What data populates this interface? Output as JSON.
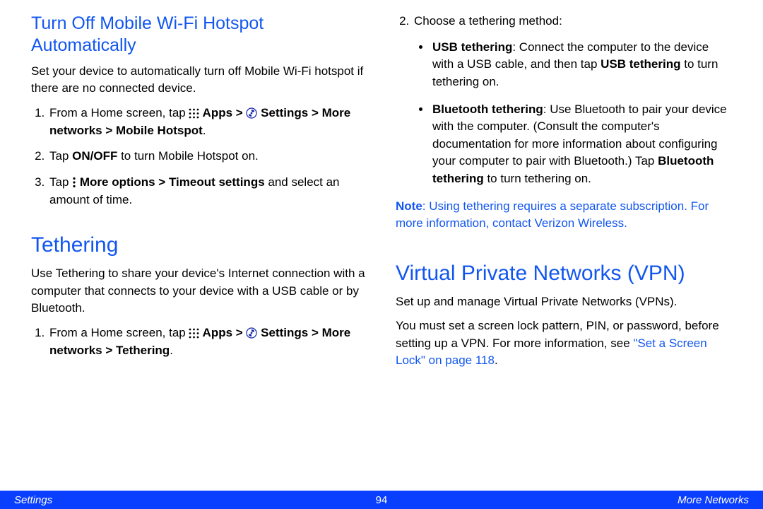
{
  "left": {
    "h2": "Turn Off Mobile Wi-Fi Hotspot Automatically",
    "p1": "Set your device to automatically turn off Mobile Wi-Fi hotspot if there are no connected device.",
    "li1_a": "From a Home screen, tap ",
    "li1_apps": " Apps > ",
    "li1_settings": " Settings > More networks > Mobile Hotspot",
    "li1_dot": ".",
    "li2_a": "Tap ",
    "li2_b": "ON/OFF",
    "li2_c": " to turn Mobile Hotspot on.",
    "li3_a": "Tap ",
    "li3_b": " More options > Timeout settings",
    "li3_c": " and select an amount of time.",
    "h1": "Tethering",
    "p2": "Use Tethering to share your device's Internet connection with a computer that connects to your device with a USB cable or by Bluetooth.",
    "li4_a": "From a Home screen, tap ",
    "li4_apps": " Apps > ",
    "li4_settings": " Settings > More networks > Tethering",
    "li4_dot": "."
  },
  "right": {
    "li1": "Choose a tethering method:",
    "usb_b": "USB tethering",
    "usb_t1": ": Connect the computer to the device with a USB cable, and then tap ",
    "usb_b2": "USB tethering",
    "usb_t2": " to turn tethering on.",
    "bt_b": "Bluetooth tethering",
    "bt_t1": ": Use Bluetooth to pair your device with the computer. (Consult the computer's documentation for more information about configuring your computer to pair with Bluetooth.) Tap ",
    "bt_b2": "Bluetooth tethering",
    "bt_t2": " to turn tethering on.",
    "note_b": "Note",
    "note_t": ": Using tethering requires a separate subscription. For more information, contact Verizon Wireless.",
    "h1": "Virtual Private Networks (VPN)",
    "p1": "Set up and manage Virtual Private Networks (VPNs).",
    "p2a": "You must set a screen lock pattern, PIN, or password, before setting up a VPN. For more information, see ",
    "p2link": "\"Set a Screen Lock\" on page 118",
    "p2b": "."
  },
  "footer": {
    "left": "Settings",
    "center": "94",
    "right": "More Networks"
  }
}
